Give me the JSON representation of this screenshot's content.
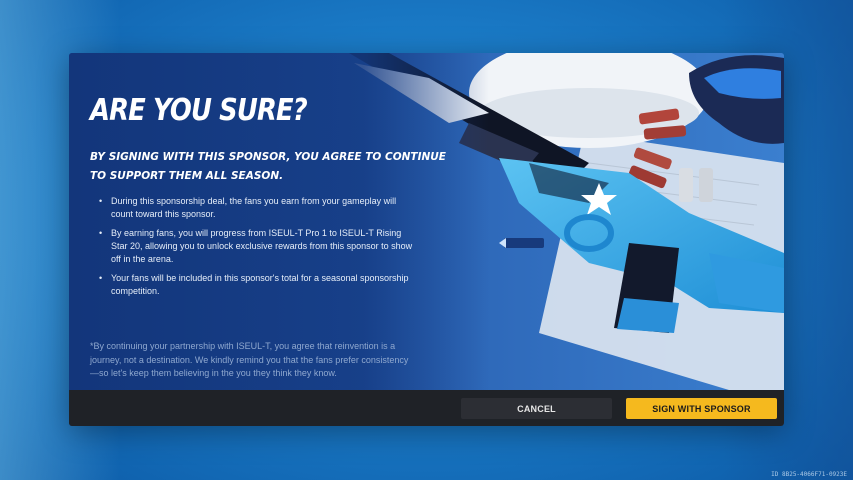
{
  "dialog": {
    "title": "ARE YOU SURE?",
    "subtitle": "BY SIGNING WITH THIS SPONSOR, YOU AGREE TO CONTINUE TO SUPPORT THEM ALL SEASON.",
    "bullets": [
      "During this sponsorship deal, the fans you earn from your gameplay will count toward this sponsor.",
      "By earning fans, you will progress from ISEUL-T Pro 1 to ISEUL-T Rising Star 20, allowing you to unlock exclusive rewards from this sponsor to show off in the arena.",
      "Your fans will be included in this sponsor's total for a seasonal sponsorship competition."
    ],
    "note": "*By continuing your partnership with ISEUL-T, you agree that reinvention is a journey, not a destination. We kindly remind you that the fans prefer consistency—so let's keep them believing in the you they think they know."
  },
  "buttons": {
    "cancel": "CANCEL",
    "sign": "SIGN WITH SPONSOR"
  },
  "watermark": "ID 8B25-4066F71-0923E",
  "colors": {
    "accent": "#f5b91e",
    "footer": "#1f2227",
    "cancel_bg": "#2c2e34",
    "panel": "#1c4a9a"
  }
}
